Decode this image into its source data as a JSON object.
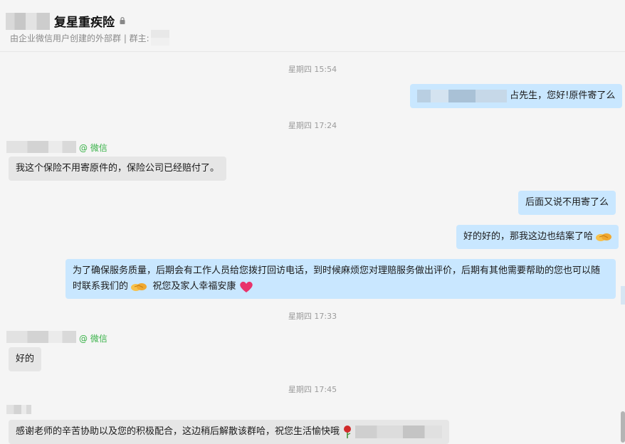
{
  "header": {
    "group_title": "复星重疾险",
    "subtitle": "由企业微信用户创建的外部群 | 群主:"
  },
  "messages": [
    {
      "type": "time",
      "text": "星期四 15:54"
    },
    {
      "type": "out",
      "text": "占先生，您好!原件寄了么"
    },
    {
      "type": "time",
      "text": "星期四 17:24"
    },
    {
      "type": "in",
      "tag": "@ 微信",
      "text": "我这个保险不用寄原件的，保险公司已经赔付了。"
    },
    {
      "type": "out",
      "text": "后面又说不用寄了么"
    },
    {
      "type": "out",
      "text": "好的好的，那我这边也结案了哈"
    },
    {
      "type": "out",
      "text_line1": "为了确保服务质量，后期会有工作人员给您拨打回访电话，到时候麻烦您对理赔服务做出评价，后期有其他需要帮助的您也可以随",
      "text_line2_a": "时联系我们的",
      "text_line2_b": "祝您及家人幸福安康"
    },
    {
      "type": "time",
      "text": "星期四 17:33"
    },
    {
      "type": "in",
      "tag": "@ 微信",
      "text": "好的"
    },
    {
      "type": "time",
      "text": "星期四 17:45"
    },
    {
      "type": "in",
      "text": "感谢老师的辛苦协助以及您的积极配合，这边稍后解散该群哈，祝您生活愉快哦"
    }
  ],
  "icons": {
    "lock": "lock-icon",
    "handshake": "handshake-icon",
    "heart": "heart-icon",
    "rose": "rose-icon"
  },
  "colors": {
    "outgoing_bubble": "#c9e7ff",
    "incoming_bubble": "#e6e6e6",
    "wechat_tag": "#3ab249"
  }
}
